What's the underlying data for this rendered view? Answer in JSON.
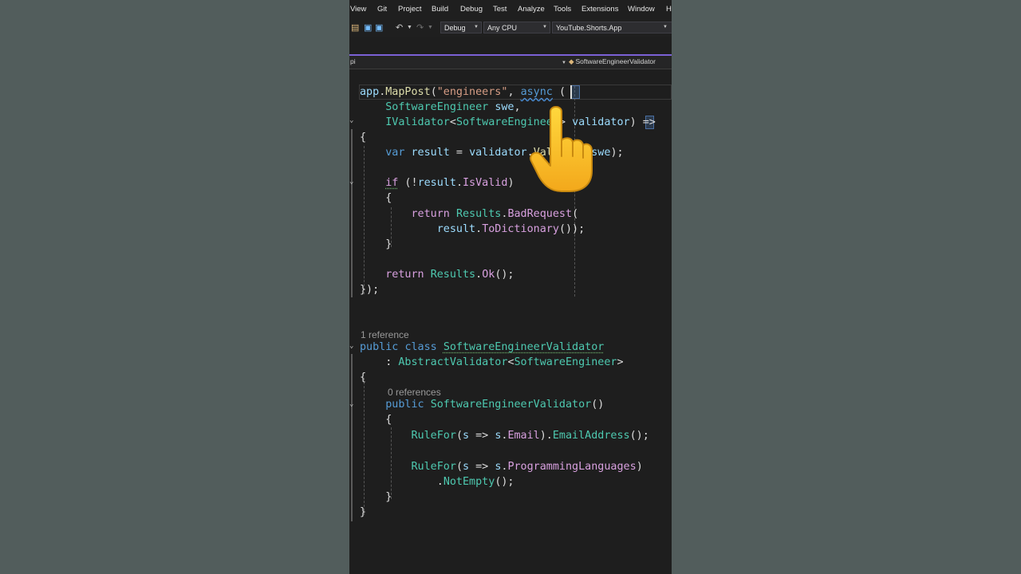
{
  "menu": [
    "View",
    "Git",
    "Project",
    "Build",
    "Debug",
    "Test",
    "Analyze",
    "Tools",
    "Extensions",
    "Window",
    "H"
  ],
  "toolbar": {
    "configuration": "Debug",
    "platform": "Any CPU",
    "startup_project": "YouTube.Shorts.App"
  },
  "navbar": {
    "left_fragment": "pi",
    "class_name": "SoftwareEngineerValidator"
  },
  "code_lens": {
    "validator_class": "1 reference",
    "constructor": "0 references"
  },
  "code": {
    "l1": {
      "a": "app",
      "b": ".",
      "c": "MapPost",
      "d": "(",
      "e": "\"engineers\"",
      "f": ", ",
      "g": "async",
      "h": " ",
      "i": "("
    },
    "l2": {
      "a": "    ",
      "b": "SoftwareEngineer",
      "c": " ",
      "d": "swe",
      "e": ","
    },
    "l3": {
      "a": "    ",
      "b": "IValidator",
      "c": "<",
      "d": "SoftwareEngineer",
      "e": "> ",
      "f": "validator",
      "g": ")",
      "h": " =>"
    },
    "l4": {
      "a": "{"
    },
    "l5": {
      "a": "    ",
      "b": "var",
      "c": " ",
      "d": "result",
      "e": " = ",
      "f": "validator",
      "g": ".",
      "h": "Validate",
      "i": "(",
      "j": "swe",
      "k": ");"
    },
    "l6": {
      "a": "    ",
      "b": "if",
      "c": " (!",
      "d": "result",
      "e": ".",
      "f": "IsValid",
      "g": ")"
    },
    "l7": {
      "a": "    {"
    },
    "l8": {
      "a": "        ",
      "b": "return",
      "c": " ",
      "d": "Results",
      "e": ".",
      "f": "BadRequest",
      "g": "("
    },
    "l9": {
      "a": "            ",
      "b": "result",
      "c": ".",
      "d": "ToDictionary",
      "e": "());"
    },
    "l10": {
      "a": "    }"
    },
    "l11": {
      "a": "    ",
      "b": "return",
      "c": " ",
      "d": "Results",
      "e": ".",
      "f": "Ok",
      "g": "();"
    },
    "l12": {
      "a": "});"
    },
    "l13": {
      "a": "public",
      "b": " ",
      "c": "class",
      "d": " ",
      "e": "SoftwareEngineerValidator"
    },
    "l14": {
      "a": "    : ",
      "b": "AbstractValidator",
      "c": "<",
      "d": "SoftwareEngineer",
      "e": ">"
    },
    "l15": {
      "a": "{"
    },
    "l16": {
      "a": "    ",
      "b": "public",
      "c": " ",
      "d": "SoftwareEngineerValidator",
      "e": "()"
    },
    "l17": {
      "a": "    {"
    },
    "l18": {
      "a": "        ",
      "b": "RuleFor",
      "c": "(",
      "d": "s",
      "e": " => ",
      "f": "s",
      "g": ".",
      "h": "Email",
      "i": ").",
      "j": "EmailAddress",
      "k": "();"
    },
    "l19": {
      "a": "        ",
      "b": "RuleFor",
      "c": "(",
      "d": "s",
      "e": " => ",
      "f": "s",
      "g": ".",
      "h": "ProgrammingLanguages",
      "i": ")"
    },
    "l20": {
      "a": "            .",
      "b": "NotEmpty",
      "c": "();"
    },
    "l21": {
      "a": "    }"
    },
    "l22": {
      "a": "}"
    }
  },
  "icons": {
    "open": "folder-open-icon",
    "save": "save-icon",
    "save_all": "save-all-icon",
    "undo": "undo-icon",
    "redo": "redo-icon",
    "dropdown": "chevron-down-icon",
    "fold": "fold-chevron-icon",
    "pointer": "pointing-hand-emoji"
  },
  "colors": {
    "editor_bg": "#1e1e1e",
    "keyword": "#569cd6",
    "control_keyword": "#d8a0df",
    "type": "#4ec9b0",
    "method": "#dcdcaa",
    "parameter": "#9cdcfe",
    "string": "#d69d85",
    "accent": "#7b61d6"
  }
}
